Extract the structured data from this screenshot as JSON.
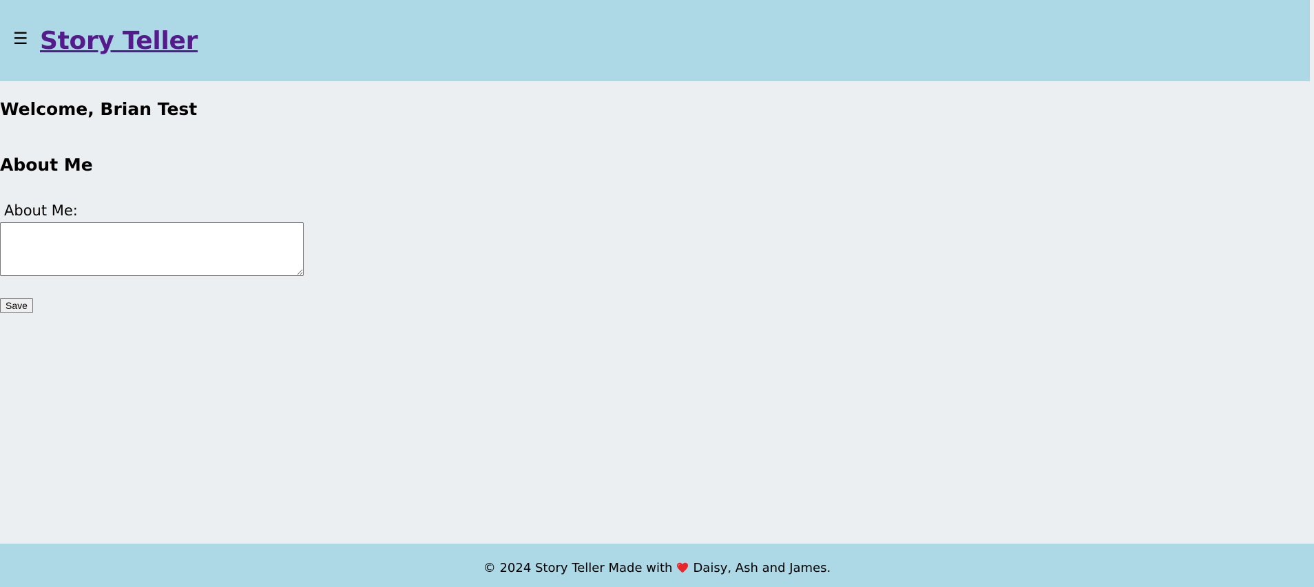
{
  "header": {
    "menu_icon": "☰",
    "site_title": "Story Teller"
  },
  "main": {
    "welcome": "Welcome, Brian Test",
    "section_title": "About Me",
    "about_label": "About Me:",
    "about_value": "",
    "save_label": "Save"
  },
  "footer": {
    "prefix": "© 2024 Story Teller Made with",
    "heart_icon": "heart-icon",
    "suffix": "Daisy, Ash and James."
  },
  "colors": {
    "header_bg": "#add8e6",
    "page_bg": "#ebeff1",
    "link": "#551a8b",
    "heart": "#e8262c"
  }
}
